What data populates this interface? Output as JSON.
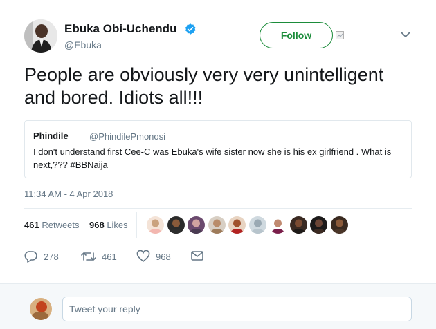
{
  "author": {
    "display_name": "Ebuka Obi-Uchendu",
    "handle": "@Ebuka",
    "verified": true,
    "avatar_icon": "profile-photo"
  },
  "follow_label": "Follow",
  "tweet_text": "People are obviously very very unintelligent and bored. Idiots all!!!",
  "quoted": {
    "name": "Phindile",
    "handle": "@PhindilePmonosi",
    "text": "I don't understand first Cee-C was Ebuka's wife sister now she is his ex girlfriend . What is next,???  #BBNaija"
  },
  "timestamp": "11:34 AM - 4 Apr 2018",
  "stats": {
    "retweets_count": "461",
    "retweets_label": "Retweets",
    "likes_count": "968",
    "likes_label": "Likes"
  },
  "liker_avatars_count": 10,
  "actions": {
    "replies": "278",
    "retweets": "461",
    "likes": "968"
  },
  "reply": {
    "placeholder": "Tweet your reply"
  },
  "colors": {
    "follow_green": "#1b8c3a",
    "verified_blue": "#1da1f2",
    "muted_gray": "#657786",
    "border": "#e1e8ed"
  }
}
